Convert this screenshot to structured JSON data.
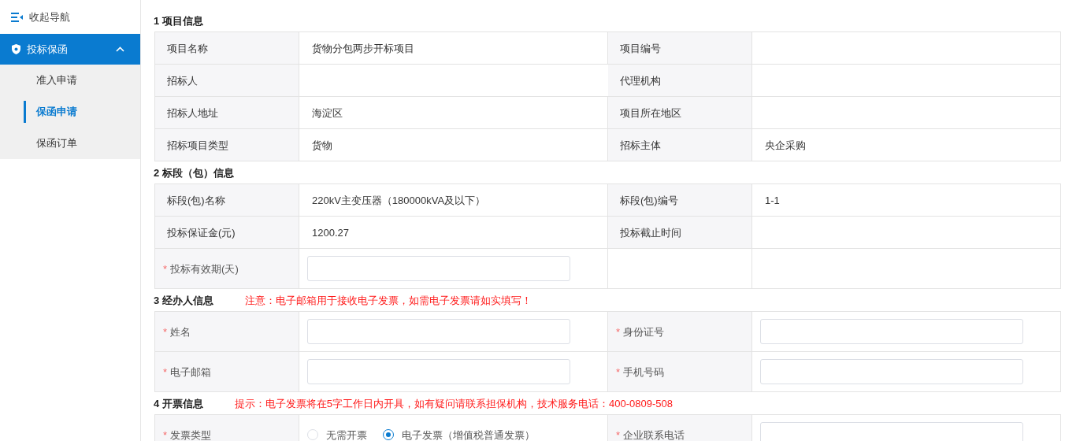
{
  "sidebar": {
    "collapse_label": "收起导航",
    "group": {
      "label": "投标保函",
      "expanded": true,
      "items": [
        {
          "label": "准入申请",
          "selected": false
        },
        {
          "label": "保函申请",
          "selected": true
        },
        {
          "label": "保函订单",
          "selected": false
        }
      ]
    }
  },
  "sections": [
    {
      "title": "1 项目信息",
      "rows": [
        [
          {
            "kind": "label",
            "text": "项目名称"
          },
          {
            "kind": "text",
            "text": "货物分包两步开标项目"
          },
          {
            "kind": "label",
            "text": "项目编号"
          },
          {
            "kind": "empty"
          }
        ],
        [
          {
            "kind": "label",
            "text": "招标人"
          },
          {
            "kind": "empty"
          },
          {
            "kind": "label",
            "text": "代理机构"
          },
          {
            "kind": "empty"
          }
        ],
        [
          {
            "kind": "label",
            "text": "招标人地址"
          },
          {
            "kind": "text",
            "text": "海淀区"
          },
          {
            "kind": "label",
            "text": "项目所在地区"
          },
          {
            "kind": "empty"
          }
        ],
        [
          {
            "kind": "label",
            "text": "招标项目类型"
          },
          {
            "kind": "text",
            "text": "货物"
          },
          {
            "kind": "label",
            "text": "招标主体"
          },
          {
            "kind": "text",
            "text": "央企采购"
          }
        ]
      ]
    },
    {
      "title": "2 标段（包）信息",
      "rows": [
        [
          {
            "kind": "label",
            "text": "标段(包)名称"
          },
          {
            "kind": "text",
            "text": "220kV主变压器（180000kVA及以下）"
          },
          {
            "kind": "label",
            "text": "标段(包)编号"
          },
          {
            "kind": "text",
            "text": "1-1"
          }
        ],
        [
          {
            "kind": "label",
            "text": "投标保证金(元)"
          },
          {
            "kind": "text",
            "text": "1200.27"
          },
          {
            "kind": "label",
            "text": "投标截止时间"
          },
          {
            "kind": "empty"
          }
        ],
        [
          {
            "kind": "label",
            "text": "投标有效期(天)",
            "mark": "*"
          },
          {
            "kind": "input"
          },
          {
            "kind": "blank"
          },
          {
            "kind": "empty"
          }
        ]
      ]
    },
    {
      "title": "3 经办人信息",
      "note": "注意：电子邮箱用于接收电子发票，如需电子发票请如实填写！",
      "rows": [
        [
          {
            "kind": "label",
            "text": "姓名",
            "mark": "*"
          },
          {
            "kind": "input"
          },
          {
            "kind": "label",
            "text": "身份证号",
            "mark": "*"
          },
          {
            "kind": "input"
          }
        ],
        [
          {
            "kind": "label",
            "text": "电子邮箱",
            "mark": "*"
          },
          {
            "kind": "input"
          },
          {
            "kind": "label",
            "text": "手机号码",
            "mark": "*"
          },
          {
            "kind": "input"
          }
        ]
      ]
    },
    {
      "title": "4 开票信息",
      "note": "提示：电子发票将在5字工作日内开具，如有疑问请联系担保机构，技术服务电话：400-0809-508",
      "rows": [
        [
          {
            "kind": "label",
            "text": "发票类型",
            "mark": "*"
          },
          {
            "kind": "radios",
            "options": [
              {
                "label": "无需开票",
                "selected": false
              },
              {
                "label": "电子发票（增值税普通发票）",
                "selected": true
              }
            ]
          },
          {
            "kind": "label",
            "text": "企业联系电话",
            "mark": "*"
          },
          {
            "kind": "input"
          }
        ]
      ]
    }
  ]
}
